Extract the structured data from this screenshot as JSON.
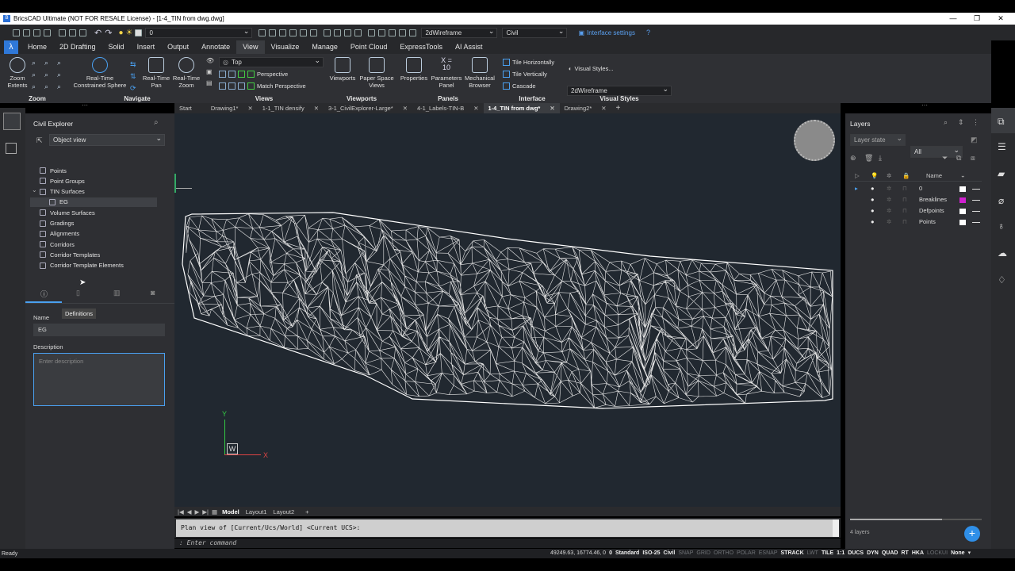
{
  "window": {
    "title": "BricsCAD Ultimate (NOT FOR RESALE License) - [1-4_TIN from dwg.dwg]"
  },
  "qat": {
    "layer_value": "0",
    "visual_style": "2dWireframe",
    "workspace": "Civil",
    "interface_settings": "Interface settings"
  },
  "ribbon_tabs": [
    "Home",
    "2D Drafting",
    "Solid",
    "Insert",
    "Output",
    "Annotate",
    "View",
    "Visualize",
    "Manage",
    "Point Cloud",
    "ExpressTools",
    "AI Assist"
  ],
  "active_tab": "View",
  "ribbon": {
    "zoom_extents": "Zoom Extents",
    "zoom_label": "Zoom",
    "rt_sphere": "Real-Time Constrained Sphere",
    "rt_pan": "Real-Time Pan",
    "rt_zoom": "Real-Time Zoom",
    "navigate_label": "Navigate",
    "view_top": "Top",
    "perspective": "Perspective",
    "match_perspective": "Match Perspective",
    "views_label": "Views",
    "viewports": "Viewports",
    "paper_space_views": "Paper Space Views",
    "viewports_label": "Viewports",
    "properties": "Properties",
    "parameters_panel": "Parameters Panel",
    "mechanical_browser": "Mechanical Browser",
    "panels_label": "Panels",
    "tile_h": "Tile Horizontally",
    "tile_v": "Tile Vertically",
    "cascade": "Cascade",
    "interface_label": "Interface",
    "visual_styles_btn": "Visual Styles...",
    "visual_style_value": "2dWireframe",
    "visual_styles_label": "Visual Styles",
    "x_eq": "X =",
    "x_val": "10"
  },
  "doc_tabs": [
    {
      "label": "Start",
      "close": ""
    },
    {
      "label": "Drawing1*",
      "close": "✕"
    },
    {
      "label": "1-1_TIN densify",
      "close": "✕"
    },
    {
      "label": "3-1_CivilExplorer-Large*",
      "close": "✕"
    },
    {
      "label": "4-1_Labels-TIN-B",
      "close": "✕"
    },
    {
      "label": "1-4_TIN from dwg*",
      "close": "✕"
    },
    {
      "label": "Drawing2*",
      "close": "✕"
    }
  ],
  "civil_explorer": {
    "title": "Civil Explorer",
    "view_select": "Object view",
    "tree": [
      "Points",
      "Point Groups",
      "TIN Surfaces",
      "EG",
      "Volume Surfaces",
      "Gradings",
      "Alignments",
      "Corridors",
      "Corridor Templates",
      "Corridor Template Elements"
    ],
    "tooltip": "Definitions",
    "name_label": "Name",
    "name_value": "EG",
    "description_label": "Description",
    "description_placeholder": "Enter description"
  },
  "viewport": {
    "ucs_y": "Y",
    "ucs_x": "X",
    "ucs_w": "W"
  },
  "layout_tabs": [
    "Model",
    "Layout1",
    "Layout2"
  ],
  "command": {
    "history": "Plan view of [Current/Ucs/World] <Current UCS>:",
    "prompt": ": Enter command"
  },
  "layers": {
    "title": "Layers",
    "layer_state": "Layer state",
    "filter": "All",
    "name_header": "Name",
    "rows": [
      {
        "name": "0",
        "color": "#ffffff"
      },
      {
        "name": "Breaklines",
        "color": "#d020d0"
      },
      {
        "name": "Defpoints",
        "color": "#ffffff"
      },
      {
        "name": "Points",
        "color": "#ffffff"
      }
    ],
    "count": "4 layers"
  },
  "status": {
    "ready": "Ready",
    "coords": "49249.63, 16774.46, 0",
    "items": [
      {
        "t": "0",
        "s": "on"
      },
      {
        "t": "Standard",
        "s": "on"
      },
      {
        "t": "ISO-25",
        "s": "on"
      },
      {
        "t": "Civil",
        "s": "on"
      },
      {
        "t": "SNAP",
        "s": "off"
      },
      {
        "t": "GRID",
        "s": "off"
      },
      {
        "t": "ORTHO",
        "s": "off"
      },
      {
        "t": "POLAR",
        "s": "off"
      },
      {
        "t": "ESNAP",
        "s": "off"
      },
      {
        "t": "STRACK",
        "s": "on"
      },
      {
        "t": "LWT",
        "s": "off"
      },
      {
        "t": "TILE",
        "s": "on"
      },
      {
        "t": "1:1",
        "s": "on"
      },
      {
        "t": "DUCS",
        "s": "on"
      },
      {
        "t": "DYN",
        "s": "on"
      },
      {
        "t": "QUAD",
        "s": "on"
      },
      {
        "t": "RT",
        "s": "on"
      },
      {
        "t": "HKA",
        "s": "on"
      },
      {
        "t": "LOCKUI",
        "s": "off"
      },
      {
        "t": "None",
        "s": "on"
      }
    ]
  }
}
